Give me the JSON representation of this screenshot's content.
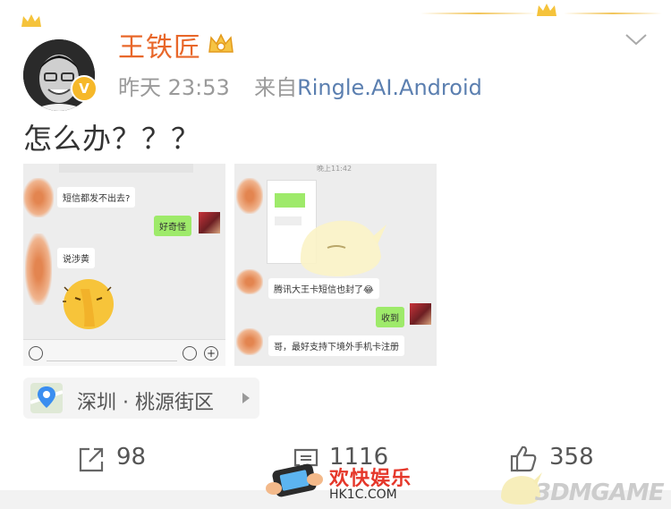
{
  "post": {
    "username": "王铁匠",
    "time": "昨天 23:53",
    "source_prefix": "来自",
    "source_name": "Ringle.AI.Android",
    "text": "怎么办？？？",
    "location": "深圳 · 桃源街区"
  },
  "screenshot1": {
    "msg1": "短信都发不出去?",
    "msg2": "好奇怪",
    "msg3": "说涉黄"
  },
  "screenshot2": {
    "time_header": "晚上11:42",
    "msg1": "腾讯大王卡短信也封了😂",
    "msg2": "收到",
    "msg3": "哥，最好支持下境外手机卡注册"
  },
  "actions": {
    "share_count": "98",
    "comment_count": "1116",
    "like_count": "358"
  },
  "watermarks": {
    "hk_title": "欢快娱乐",
    "hk_domain": "HK1C.COM",
    "dm": "3DMGAME"
  },
  "colors": {
    "username": "#e8672a",
    "source_link": "#5b7fb0",
    "vip_badge": "#f6b829"
  }
}
